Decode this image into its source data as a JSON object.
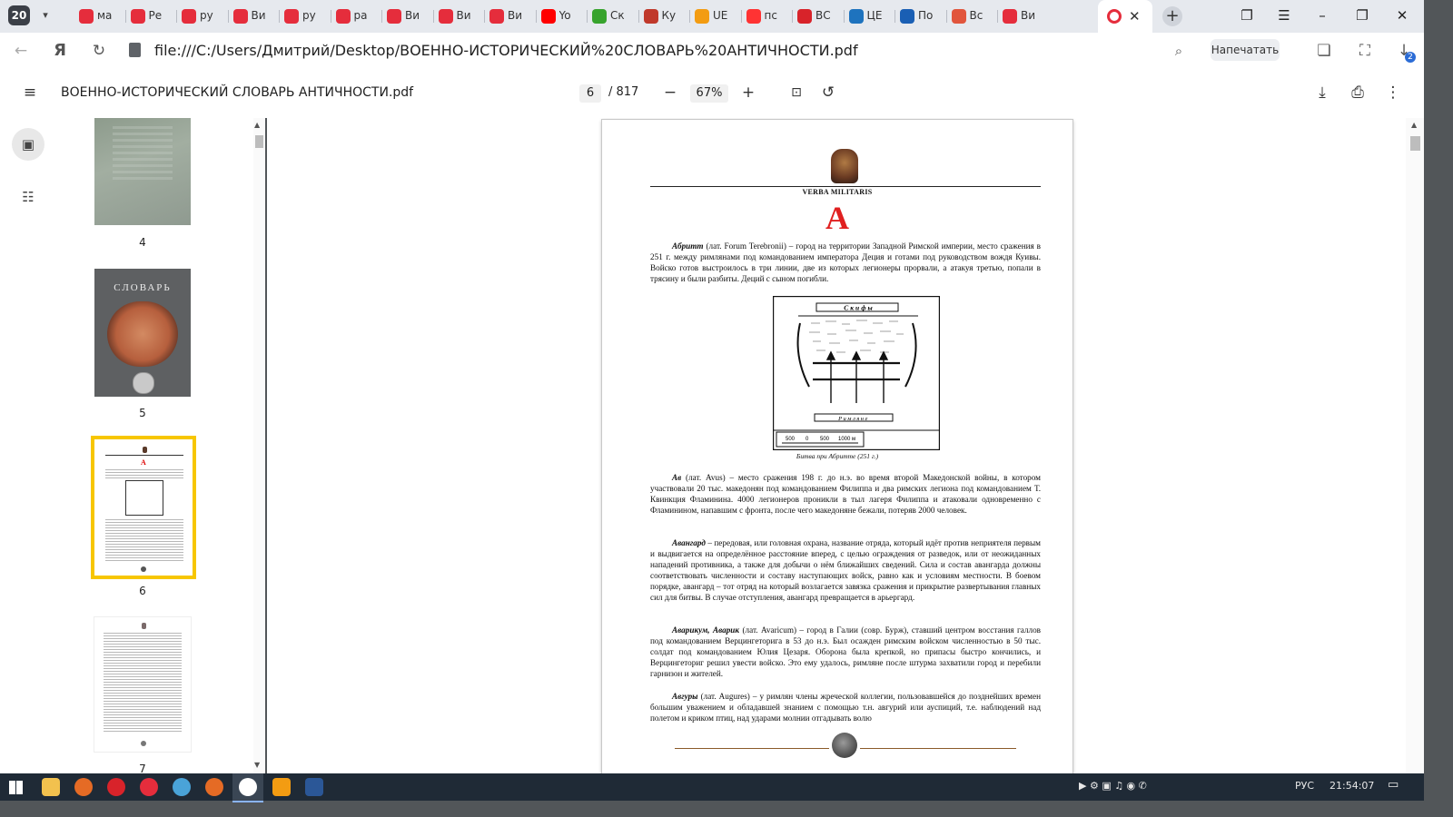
{
  "browser": {
    "tab_count": "20",
    "tabs": [
      {
        "title": "ма",
        "color": "#e52d3c"
      },
      {
        "title": "Ре",
        "color": "#e52d3c"
      },
      {
        "title": "ру",
        "color": "#e52d3c"
      },
      {
        "title": "Ви",
        "color": "#e52d3c"
      },
      {
        "title": "ру",
        "color": "#e52d3c"
      },
      {
        "title": "ра",
        "color": "#e52d3c"
      },
      {
        "title": "Ви",
        "color": "#e52d3c"
      },
      {
        "title": "Ви",
        "color": "#e52d3c"
      },
      {
        "title": "Ви",
        "color": "#e52d3c"
      },
      {
        "title": "Yo",
        "color": "#ff0000"
      },
      {
        "title": "Ск",
        "color": "#37a32d"
      },
      {
        "title": "Ку",
        "color": "#c0392b"
      },
      {
        "title": "UE",
        "color": "#f39c12"
      },
      {
        "title": "пс",
        "color": "#f33"
      },
      {
        "title": "ВС",
        "color": "#d8232a"
      },
      {
        "title": "ЦЕ",
        "color": "#1e73be"
      },
      {
        "title": "По",
        "color": "#1a5fb4"
      },
      {
        "title": "Вс",
        "color": "#e1553c"
      },
      {
        "title": "Ви",
        "color": "#e52d3c"
      }
    ],
    "active_tab_color": "#e52d3c",
    "url": "file:///C:/Users/Дмитрий/Desktop/ВОЕННО-ИСТОРИЧЕСКИЙ%20СЛОВАРЬ%20АНТИЧНОСТИ.pdf",
    "print_label": "Напечатать",
    "downloads_badge": "2"
  },
  "pdf": {
    "title": "ВОЕННО-ИСТОРИЧЕСКИЙ СЛОВАРЬ АНТИЧНОСТИ.pdf",
    "current_page": "6",
    "total_pages": "/ 817",
    "zoom": "67%",
    "accent": "#f7c600"
  },
  "thumbnails": [
    {
      "num": "4"
    },
    {
      "num": "5",
      "caption": "СЛОВАРЬ"
    },
    {
      "num": "6",
      "selected": true
    },
    {
      "num": "7"
    }
  ],
  "page": {
    "header": "VERBA MILITARIS",
    "letter": "А",
    "entries": [
      {
        "term": "Абритт",
        "body": " (лат. Forum Terebronii) – город на территории Западной Римской империи, место сражения в 251 г. между римлянами под командованием императора Деция и готами под руководством вождя Куивы. Войско готов выстроилось в три линии, две из которых легионеры прорвали, а атакуя третью, попали в трясину и были разбиты. Деций с сыном погибли."
      },
      {
        "term": "Ав",
        "body": " (лат. Avus) – место сражения 198 г. до н.э. во время второй Македонской войны, в котором участвовали 20 тыс. македонян под командованием Филиппа и два римских легиона под командованием Т. Квинкция Фламинина. 4000 легионеров проникли в тыл лагеря Филиппа и атаковали одновременно с Фламинином, напавшим с фронта, после чего македоняне бежали, потеряв 2000 человек."
      },
      {
        "term": "Авангард",
        "body": " – передовая, или головная охрана, название отряда, который идёт против неприятеля первым и выдвигается на определённое расстояние вперед, с целью ограждения от разведок, или от неожиданных нападений противника, а также для добычи о нём ближайших сведений. Сила и состав авангарда должны соответствовать численности и составу наступающих войск, равно как и условиям местности. В боевом порядке, авангард – тот отряд на который возлагается завязка сражения и прикрытие развертывания главных сил для битвы. В случае отступления, авангард превращается в арьергард."
      },
      {
        "term": "Аварикум, Аварик",
        "body": " (лат. Avaricum) – город в Галии (совр. Бурж), ставший центром восстания галлов под командованием Верцингеторига в 53 до н.э. Был осажден римским войском численностью в 50 тыс. солдат под командованием Юлия Цезаря. Оборона была крепкой, но припасы быстро кончились, и Верцингеториг решил увести войско. Это ему удалось, римляне после штурма захватили город и перебили гарнизон и жителей."
      },
      {
        "term": "Авгуры",
        "body": " (лат. Augures) – у римлян члены жреческой коллегии, пользовавшейся до позднейших времен большим уважением и обладавшей знанием с помощью т.н. авгурий или ауспиций, т.е. наблюдений над полетом и криком птиц, над ударами молнии отгадывать волю"
      }
    ],
    "map": {
      "top_label": "Скифы",
      "bottom_label": "Римляне",
      "scale_labels": [
        "500",
        "0",
        "500",
        "1000 м"
      ],
      "caption": "Битва при Абритте (251 г.)"
    }
  },
  "taskbar": {
    "lang": "РУС",
    "time": "21:54:07"
  }
}
